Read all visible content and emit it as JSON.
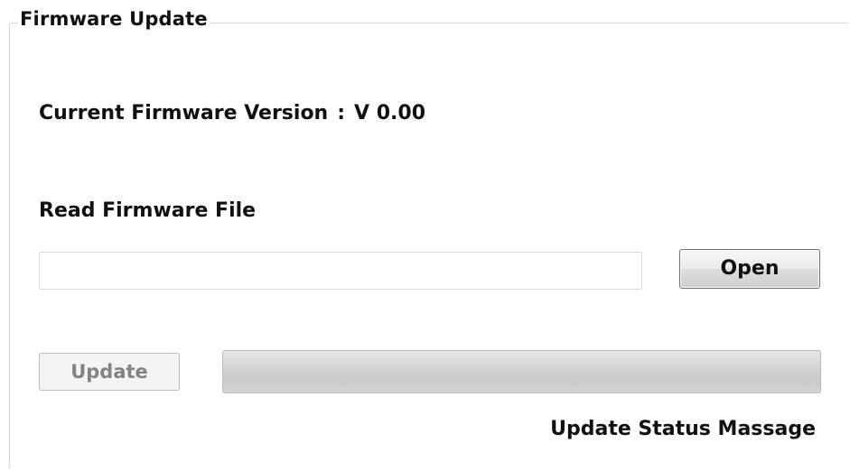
{
  "group": {
    "title": "Firmware Update"
  },
  "version": {
    "label": "Current Firmware Version",
    "separator": ":",
    "value": "V 0.00"
  },
  "file": {
    "label": "Read Firmware File",
    "value": "",
    "placeholder": ""
  },
  "buttons": {
    "open_label": "Open",
    "update_label": "Update",
    "update_enabled": false
  },
  "progress": {
    "value_percent": 0
  },
  "status": {
    "message": "Update Status Massage"
  }
}
